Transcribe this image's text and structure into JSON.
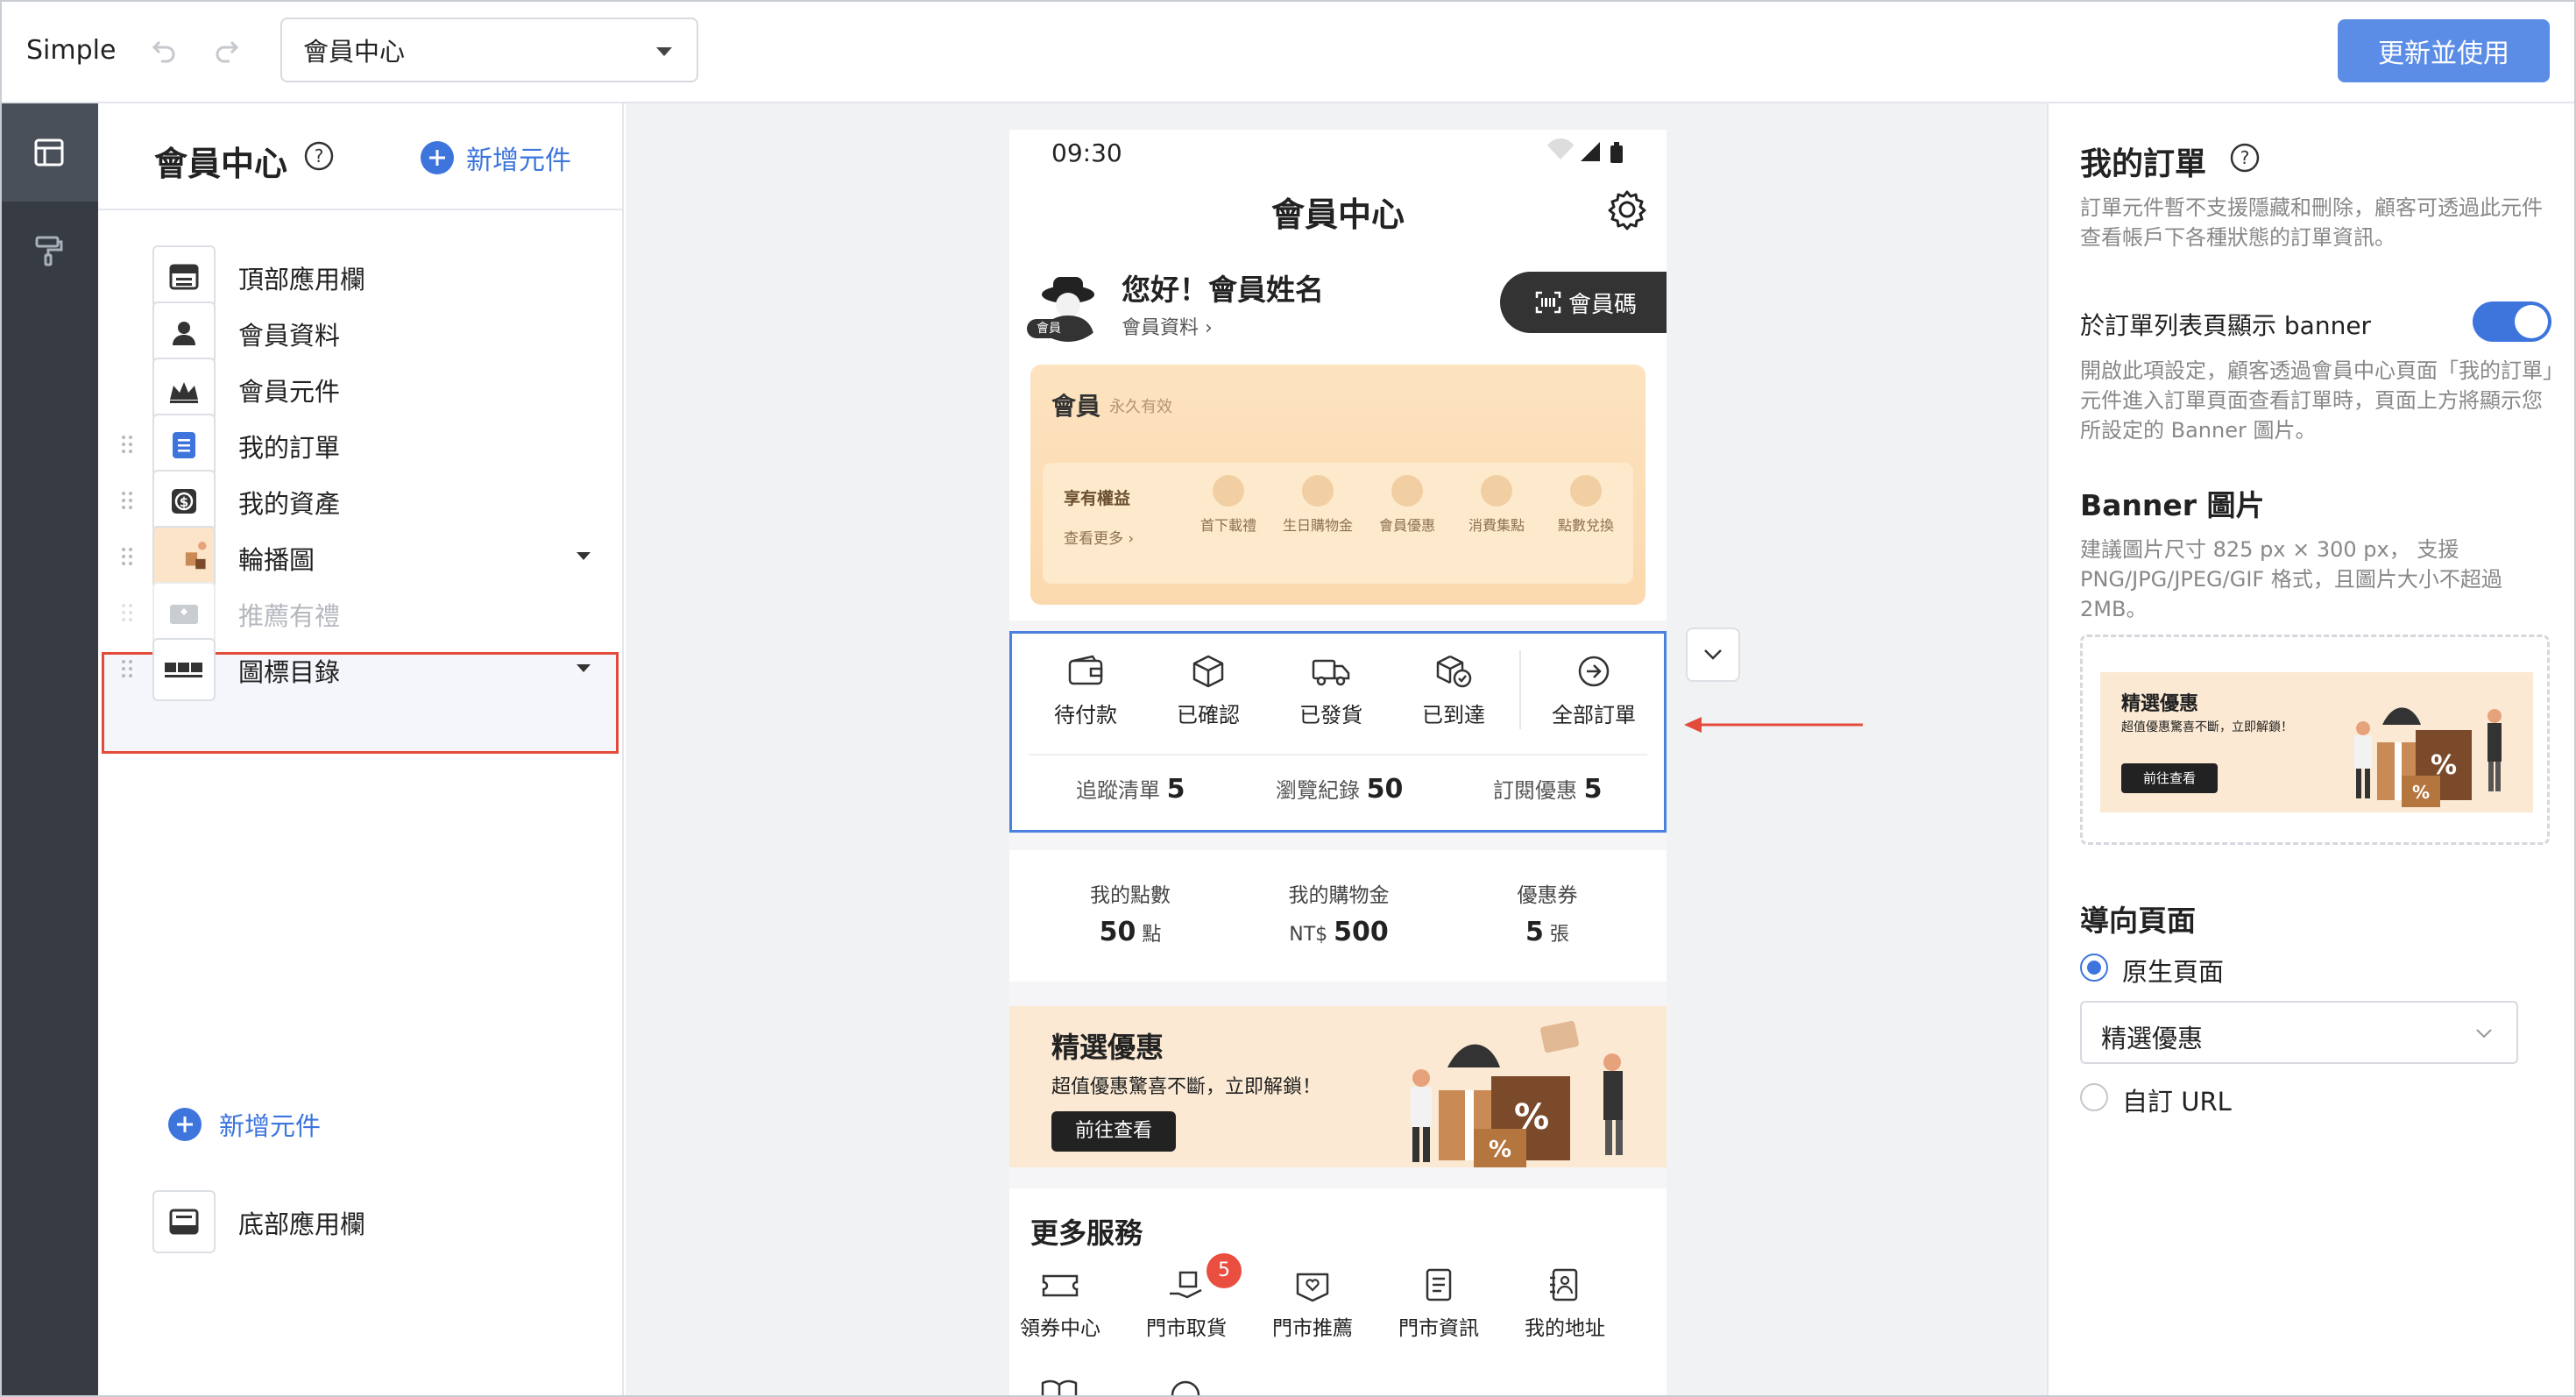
{
  "topbar": {
    "app_name": "Simple",
    "page_select_value": "會員中心",
    "publish_label": "更新並使用"
  },
  "components": {
    "title": "會員中心",
    "add_label": "新增元件",
    "items": [
      {
        "label": "頂部應用欄",
        "icon": "header-bar-icon"
      },
      {
        "label": "會員資料",
        "icon": "user-icon"
      },
      {
        "label": "會員元件",
        "icon": "crown-icon"
      },
      {
        "label": "我的訂單",
        "icon": "order-list-icon",
        "selected": true
      },
      {
        "label": "我的資產",
        "icon": "dollar-icon"
      },
      {
        "label": "輪播圖",
        "icon": "carousel-thumb-icon"
      },
      {
        "label": "推薦有禮",
        "icon": "gift-icon",
        "disabled": true
      },
      {
        "label": "圖標目錄",
        "icon": "grid-icon"
      }
    ],
    "add_bottom_label": "新增元件",
    "footer_item_label": "底部應用欄"
  },
  "phone": {
    "time": "09:30",
    "title": "會員中心",
    "avatar_badge": "會員",
    "greeting": "您好！會員姓名",
    "profile_link": "會員資料 ›",
    "member_code": "會員碼",
    "card": {
      "level": "會員",
      "validity": "永久有效",
      "benefits_title": "享有權益",
      "benefits_more": "查看更多 ›",
      "benefits": [
        "首下載禮",
        "生日購物金",
        "會員優惠",
        "消費集點",
        "點數兌換"
      ]
    },
    "orders": {
      "statuses": [
        "待付款",
        "已確認",
        "已發貨",
        "已到達",
        "全部訂單"
      ],
      "stats": [
        {
          "label": "追蹤清單",
          "value": "5"
        },
        {
          "label": "瀏覽紀錄",
          "value": "50"
        },
        {
          "label": "訂閱優惠",
          "value": "5"
        }
      ]
    },
    "points": [
      {
        "label": "我的點數",
        "value": "50",
        "unit": "點",
        "prefix": ""
      },
      {
        "label": "我的購物金",
        "value": "500",
        "unit": "",
        "prefix": "NT$"
      },
      {
        "label": "優惠券",
        "value": "5",
        "unit": "張",
        "prefix": ""
      }
    ],
    "banner": {
      "title": "精選優惠",
      "subtitle": "超值優惠驚喜不斷，立即解鎖！",
      "button": "前往查看"
    },
    "services": {
      "title": "更多服務",
      "items": [
        "領券中心",
        "門市取貨",
        "門市推薦",
        "門市資訊",
        "我的地址"
      ],
      "badge": "5"
    }
  },
  "settings": {
    "title": "我的訂單",
    "note": "訂單元件暫不支援隱藏和刪除，顧客可透過此元件查看帳戶下各種狀態的訂單資訊。",
    "banner_toggle_label": "於訂單列表頁顯示 banner",
    "banner_toggle_on": true,
    "banner_toggle_desc": "開啟此項設定，顧客透過會員中心頁面「我的訂單」元件進入訂單頁面查看訂單時，頁面上方將顯示您所設定的 Banner 圖片。",
    "banner_image_title": "Banner 圖片",
    "banner_image_desc": "建議圖片尺寸 825 px × 300 px， 支援 PNG/JPG/JPEG/GIF 格式，且圖片大小不超過 2MB。",
    "preview": {
      "title": "精選優惠",
      "subtitle": "超值優惠驚喜不斷，立即解鎖！",
      "button": "前往查看"
    },
    "nav_title": "導向頁面",
    "nav_option_native": "原生頁面",
    "nav_select_value": "精選優惠",
    "nav_option_custom": "自訂 URL"
  },
  "colors": {
    "accent": "#3d75dd",
    "publish": "#5b8de6",
    "highlight_border": "#e34b3a",
    "rail_bg": "#363b44",
    "canvas_bg": "#f1f2f4",
    "card_bg": "#fcddb4"
  }
}
